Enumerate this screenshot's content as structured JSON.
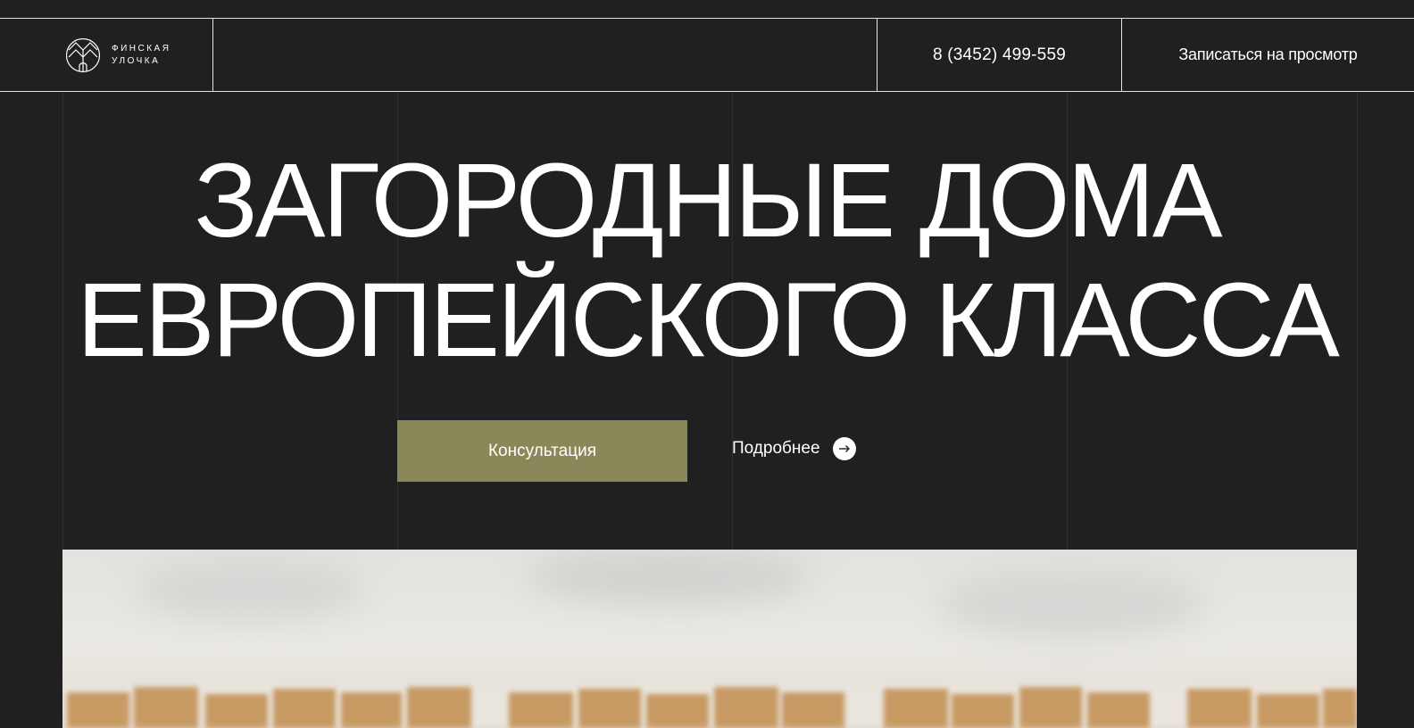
{
  "brand": {
    "line1": "ФИНСКАЯ",
    "line2": "УЛОЧКА",
    "logo_icon": "house-logo-icon"
  },
  "header": {
    "phone": "8 (3452) 499-559",
    "cta_label": "Записаться на просмотр"
  },
  "hero": {
    "title_line1": "ЗАГОРОДНЫЕ ДОМА",
    "title_line2": "ЕВРОПЕЙСКОГО КЛАССА",
    "consult_label": "Консультация",
    "more_label": "Подробнее",
    "more_icon": "arrow-right-icon"
  },
  "colors": {
    "background": "#202020",
    "accent": "#8a8858",
    "text": "#ffffff"
  }
}
